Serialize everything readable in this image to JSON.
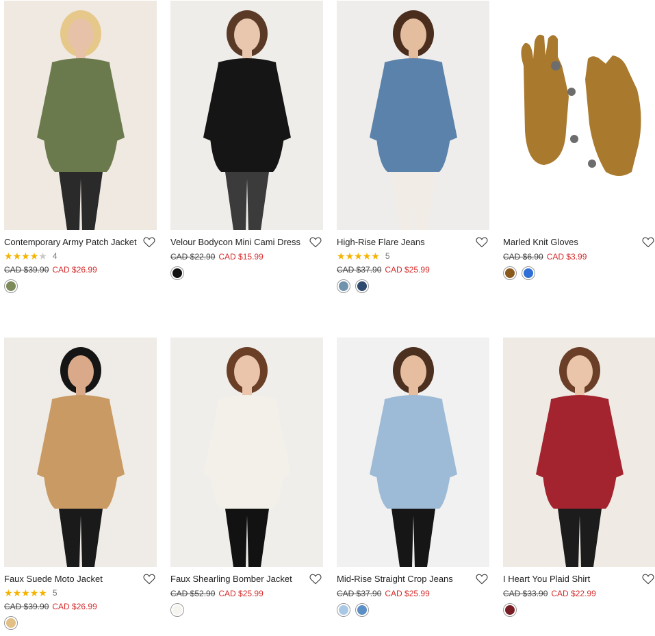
{
  "products": [
    {
      "name": "Contemporary Army Patch Jacket",
      "rating": 4,
      "review_count": "4",
      "original_price": "CAD $39.90",
      "sale_price": "CAD $26.99",
      "swatches": [
        "#7d8a5a"
      ],
      "image_colors": {
        "bg": "#efe9e1",
        "main": "#6b7a4c",
        "accent": "#2a2a2a",
        "skin": "#e8c2a8",
        "hair": "#e6c98a"
      }
    },
    {
      "name": "Velour Bodycon Mini Cami Dress",
      "original_price": "CAD $22.90",
      "sale_price": "CAD $15.99",
      "swatches": [
        "#111111"
      ],
      "image_colors": {
        "bg": "#efedea",
        "main": "#151515",
        "accent": "#3b3b3b",
        "skin": "#e9c6ae",
        "hair": "#5a3a26"
      }
    },
    {
      "name": "High-Rise Flare Jeans",
      "rating": 5,
      "review_count": "5",
      "original_price": "CAD $37.90",
      "sale_price": "CAD $25.99",
      "swatches": [
        "#6f93ad",
        "#2e4a6e"
      ],
      "image_colors": {
        "bg": "#eeedec",
        "main": "#5b82aa",
        "accent": "#f1ece6",
        "skin": "#e4bd9f",
        "hair": "#4a2d1c"
      }
    },
    {
      "name": "Marled Knit Gloves",
      "original_price": "CAD $6.90",
      "sale_price": "CAD $3.99",
      "swatches": [
        "#8a5a1c",
        "#2f6fd6"
      ],
      "image_colors": {
        "bg": "#ffffff",
        "main": "#a97a2e",
        "accent": "#6d6d6d",
        "skin": "#a97a2e",
        "hair": "#a97a2e"
      }
    },
    {
      "name": "Faux Suede Moto Jacket",
      "rating": 5,
      "review_count": "5",
      "original_price": "CAD $39.90",
      "sale_price": "CAD $26.99",
      "swatches": [
        "#e2bf85"
      ],
      "image_colors": {
        "bg": "#efece7",
        "main": "#c99a63",
        "accent": "#1a1a1a",
        "skin": "#d9a98a",
        "hair": "#151515"
      }
    },
    {
      "name": "Faux Shearling Bomber Jacket",
      "original_price": "CAD $52.90",
      "sale_price": "CAD $25.99",
      "swatches": [
        "#f6f4ef"
      ],
      "image_colors": {
        "bg": "#f0eeeb",
        "main": "#f3f0ea",
        "accent": "#121212",
        "skin": "#ebc5ab",
        "hair": "#6a3f26"
      }
    },
    {
      "name": "Mid-Rise Straight Crop Jeans",
      "original_price": "CAD $37.90",
      "sale_price": "CAD $25.99",
      "swatches": [
        "#a9c8e6",
        "#5b8fc5"
      ],
      "image_colors": {
        "bg": "#f1f1f1",
        "main": "#9dbbd6",
        "accent": "#161616",
        "skin": "#e6bd9e",
        "hair": "#4b2f1f"
      }
    },
    {
      "name": "I Heart You Plaid Shirt",
      "original_price": "CAD $33.90",
      "sale_price": "CAD $22.99",
      "swatches": [
        "#7a1e26"
      ],
      "image_colors": {
        "bg": "#efeae4",
        "main": "#a3232e",
        "accent": "#1c1c1c",
        "skin": "#ebc5aa",
        "hair": "#6b3f27"
      }
    }
  ],
  "icons": {
    "wishlist": "heart-outline-icon",
    "star": "star-icon"
  }
}
